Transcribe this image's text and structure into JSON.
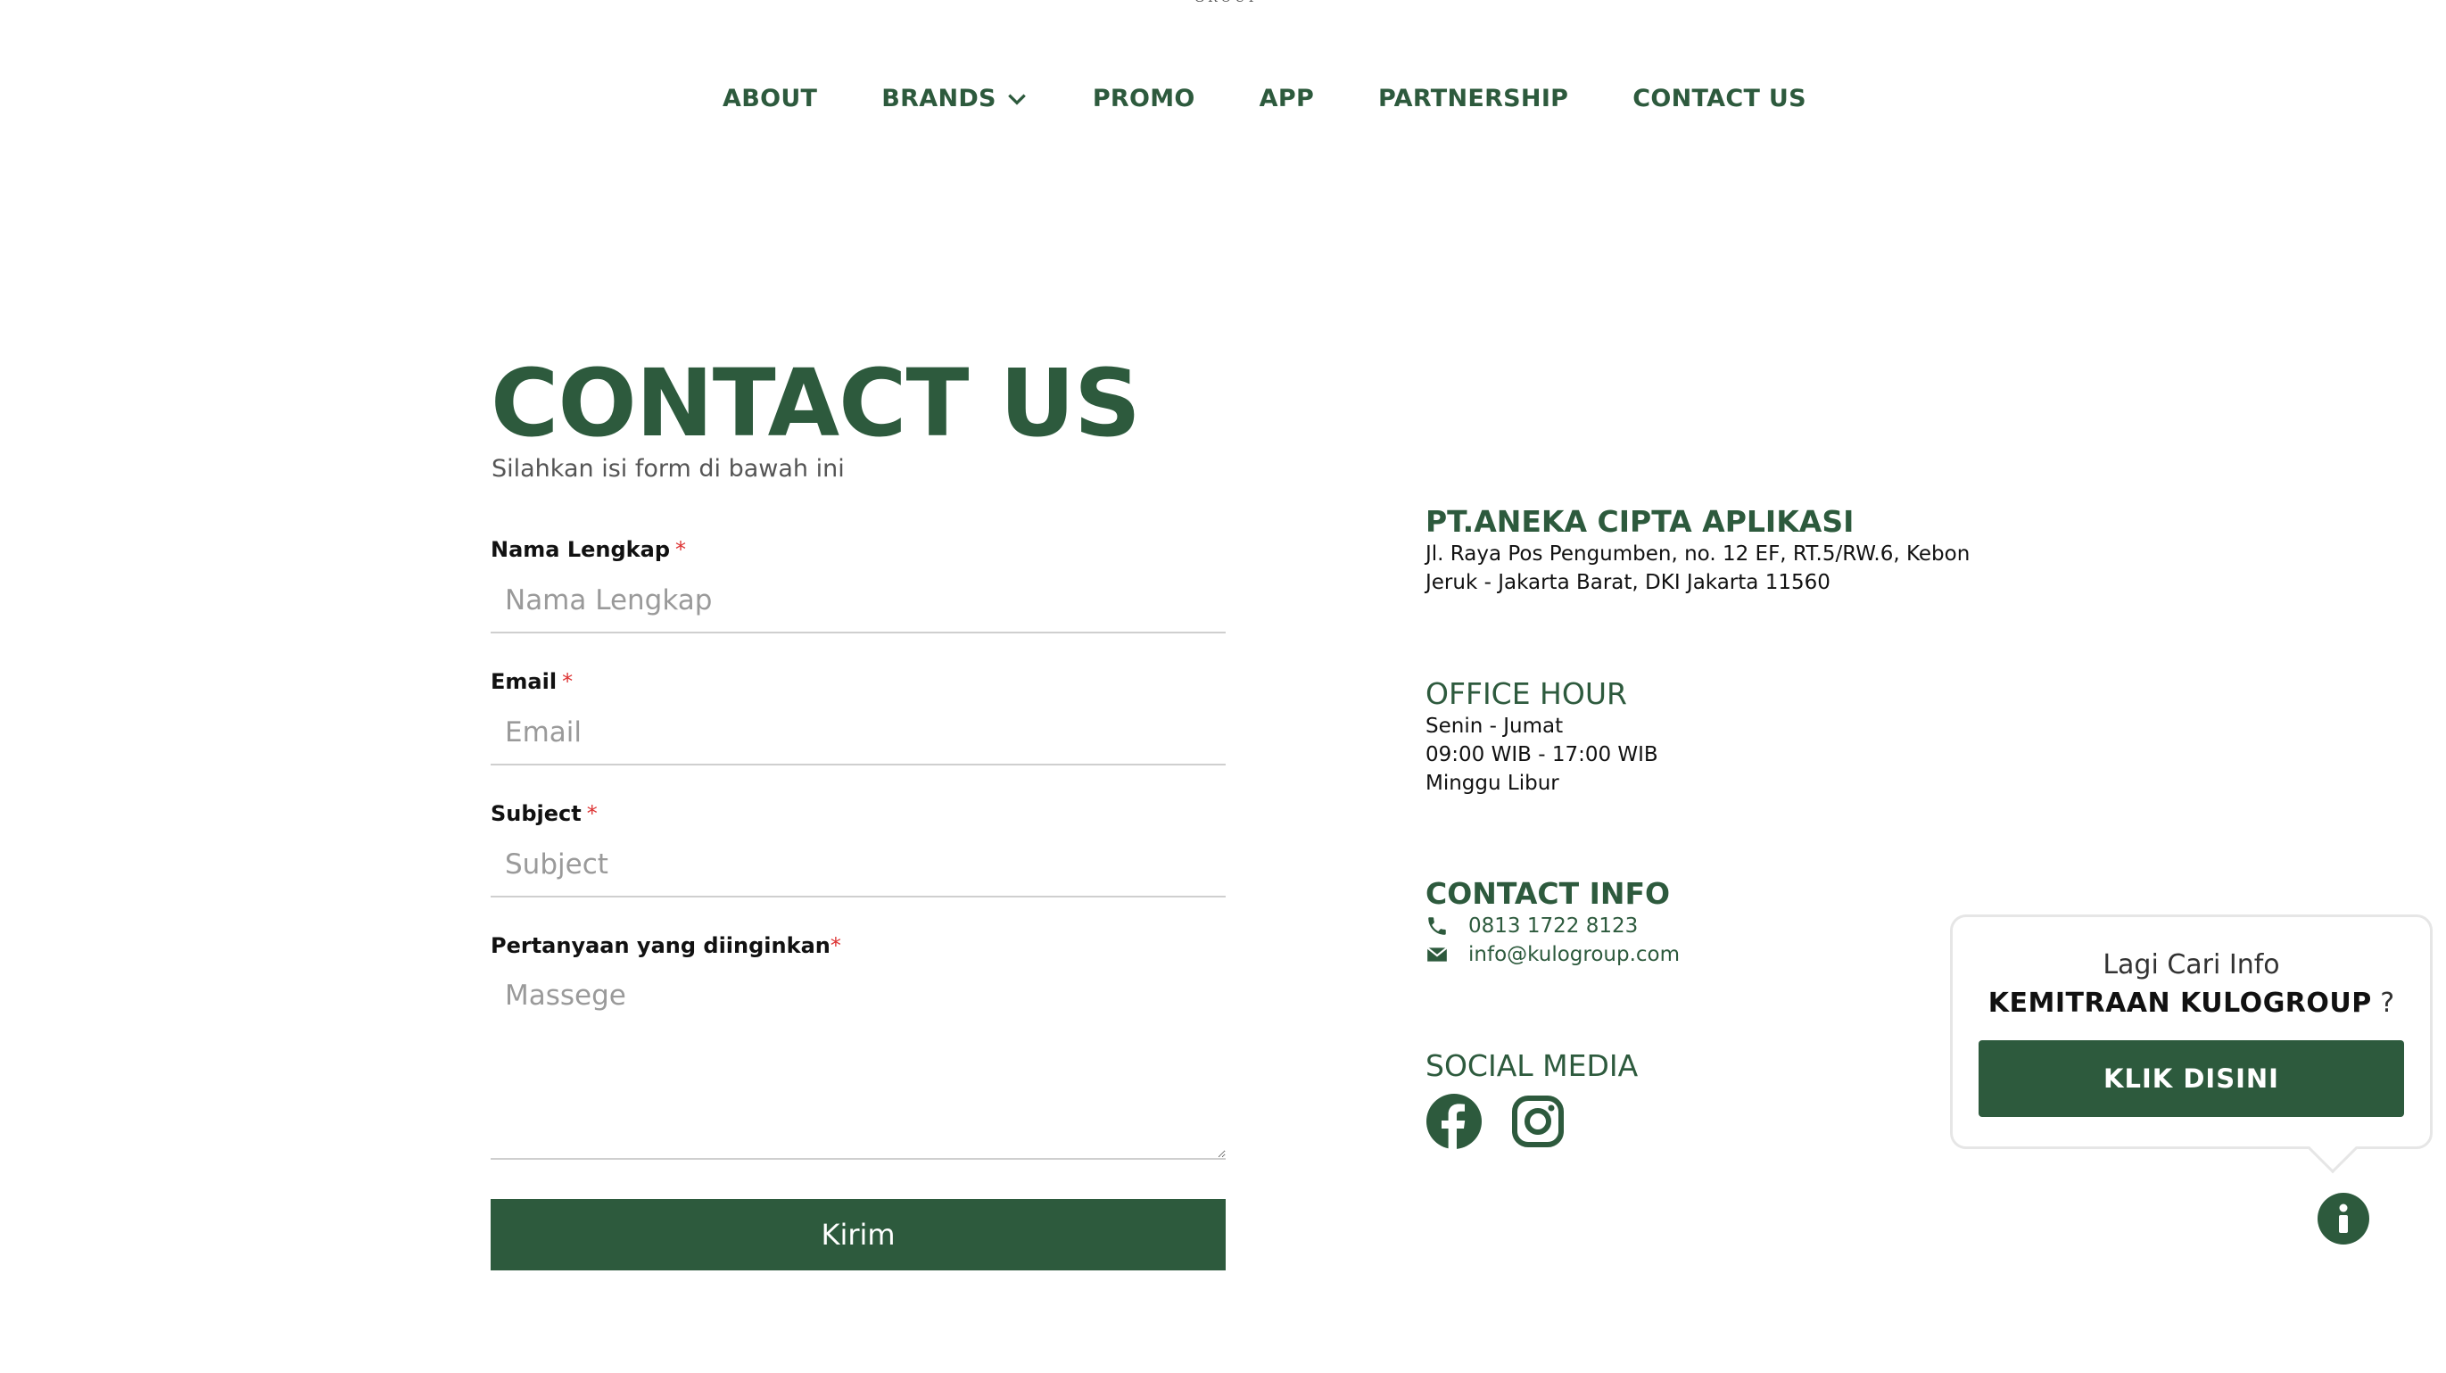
{
  "brand": {
    "logo_fragment": "GROUP"
  },
  "nav": {
    "items": [
      {
        "label": "ABOUT"
      },
      {
        "label": "BRANDS"
      },
      {
        "label": "PROMO"
      },
      {
        "label": "APP"
      },
      {
        "label": "PARTNERSHIP"
      },
      {
        "label": "CONTACT US"
      }
    ],
    "brands_icon": "chevron-down-icon"
  },
  "page": {
    "title": "CONTACT US",
    "subtitle": "Silahkan isi form di bawah ini"
  },
  "form": {
    "name": {
      "label": "Nama Lengkap",
      "required": "*",
      "placeholder": "Nama Lengkap",
      "value": ""
    },
    "email": {
      "label": "Email",
      "required": "*",
      "placeholder": "Email",
      "value": ""
    },
    "subject": {
      "label": "Subject",
      "required": "*",
      "placeholder": "Subject",
      "value": ""
    },
    "message": {
      "label": "Pertanyaan yang diinginkan",
      "required": "*",
      "placeholder": "Massege",
      "value": ""
    },
    "submit_label": "Kirim"
  },
  "company": {
    "name": "PT.ANEKA CIPTA APLIKASI",
    "address_line1": "Jl. Raya Pos Pengumben, no. 12 EF, RT.5/RW.6, Kebon",
    "address_line2": "Jeruk - Jakarta Barat, DKI Jakarta 11560"
  },
  "office_hour": {
    "heading": "OFFICE HOUR",
    "days": "Senin - Jumat",
    "hours": "09:00 WIB - 17:00 WIB",
    "closed": "Minggu Libur"
  },
  "contact_info": {
    "heading": "CONTACT INFO",
    "phone": "0813 1722 8123",
    "email": "info@kulogroup.com",
    "phone_icon": "phone-icon",
    "email_icon": "envelope-icon"
  },
  "social": {
    "heading": "SOCIAL MEDIA",
    "icons": [
      "facebook-icon",
      "instagram-icon"
    ]
  },
  "popup": {
    "line1": "Lagi Cari Info",
    "line2_bold": "KEMITRAAN KULOGROUP",
    "line2_suffix": " ?",
    "cta_label": "KLIK DISINI"
  },
  "colors": {
    "primary": "#2d5a3d",
    "required": "#dd3333",
    "text": "#111111",
    "muted": "#555555",
    "border": "#cfcfcf"
  }
}
